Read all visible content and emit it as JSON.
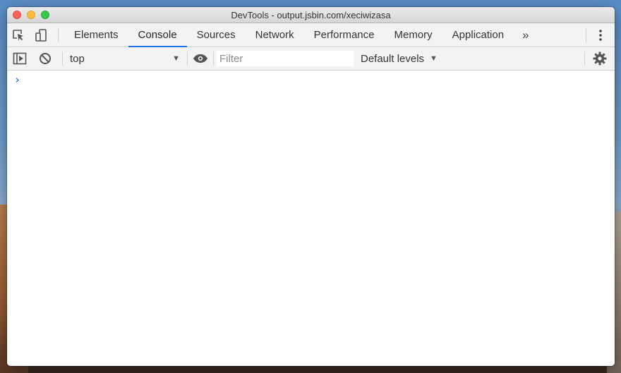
{
  "window": {
    "title": "DevTools - output.jsbin.com/xeciwizasa"
  },
  "tabs": [
    {
      "label": "Elements",
      "active": false
    },
    {
      "label": "Console",
      "active": true
    },
    {
      "label": "Sources",
      "active": false
    },
    {
      "label": "Network",
      "active": false
    },
    {
      "label": "Performance",
      "active": false
    },
    {
      "label": "Memory",
      "active": false
    },
    {
      "label": "Application",
      "active": false
    }
  ],
  "tabbar": {
    "more_label": "»"
  },
  "toolbar": {
    "context": "top",
    "filter_placeholder": "Filter",
    "levels_label": "Default levels"
  },
  "console": {
    "prompt": "›"
  },
  "colors": {
    "accent": "#1a73e8"
  }
}
